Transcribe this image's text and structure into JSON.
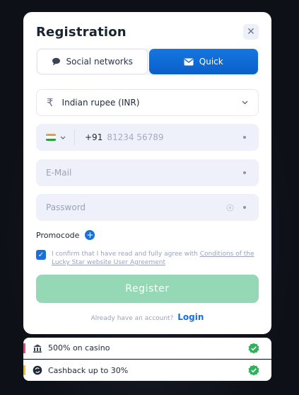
{
  "modal": {
    "title": "Registration",
    "close_icon": "close-icon"
  },
  "tabs": [
    {
      "label": "Social networks",
      "icon": "chat-bubble-icon",
      "active": false
    },
    {
      "label": "Quick",
      "icon": "envelope-icon",
      "active": true
    }
  ],
  "form": {
    "currency": {
      "value": "Indian rupee (INR)",
      "icon": "rupee-icon"
    },
    "phone": {
      "country_code": "+91",
      "placeholder": "81234 56789"
    },
    "email": {
      "placeholder": "E-Mail"
    },
    "password": {
      "placeholder": "Password"
    },
    "promocode_label": "Promocode",
    "consent": {
      "text": "I confirm that I have read and fully agree with ",
      "link": "Conditions of the Lucky Star website User Agreement",
      "checked": true
    },
    "register_label": "Register"
  },
  "login": {
    "prompt": "Already have an account?",
    "link": "Login"
  },
  "bonuses": [
    {
      "label": "500% on casino",
      "icon": "casino-building-icon"
    },
    {
      "label": "Cashback up to 30%",
      "icon": "cashback-icon"
    }
  ],
  "colors": {
    "accent": "#1a6fde",
    "register_button": "#94d8b5",
    "check_badge": "#2fb35a",
    "background": "#0e1117"
  }
}
